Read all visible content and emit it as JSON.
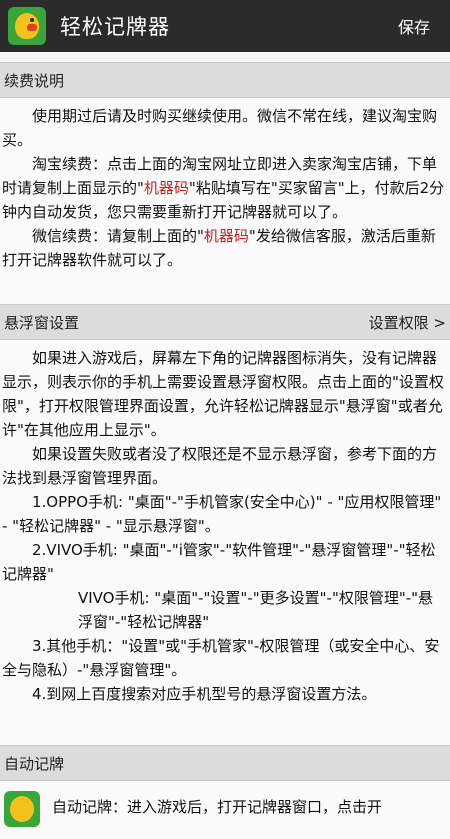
{
  "appbar": {
    "title": "轻松记牌器",
    "save_label": "保存"
  },
  "renewal": {
    "header": "续费说明",
    "p1": "使用期过后请及时购买继续使用。微信不常在线，建议淘宝购买。",
    "p2_prefix": "淘宝续费：点击上面的淘宝网址立即进入卖家淘宝店铺，下单时请复制上面显示的\"",
    "machine_code_1": "机器码",
    "p2_suffix": "\"粘贴填写在\"买家留言\"上，付款后2分钟内自动发货，您只需要重新打开记牌器就可以了。",
    "p3_prefix": "微信续费：请复制上面的\"",
    "machine_code_2": "机器码",
    "p3_suffix": "\"发给微信客服，激活后重新打开记牌器软件就可以了。"
  },
  "floating": {
    "header": "悬浮窗设置",
    "permission_link": "设置权限 >",
    "p1": "如果进入游戏后，屏幕左下角的记牌器图标消失，没有记牌器显示，则表示你的手机上需要设置悬浮窗权限。点击上面的\"设置权限\"，打开权限管理界面设置，允许轻松记牌器显示\"悬浮窗\"或者允许\"在其他应用上显示\"。",
    "p2": "如果设置失败或者没了权限还是不显示悬浮窗，参考下面的方法找到悬浮窗管理界面。",
    "oppo": "1.OPPO手机: \"桌面\"-\"手机管家(安全中心)\" - \"应用权限管理\" - \"轻松记牌器\" - \"显示悬浮窗\"。",
    "vivo1": "2.VIVO手机: \"桌面\"-\"i管家\"-\"软件管理\"-\"悬浮窗管理\"-\"轻松记牌器\"",
    "vivo2": "VIVO手机: \"桌面\"-\"设置\"-\"更多设置\"-\"权限管理\"-\"悬浮窗\"-\"轻松记牌器\"",
    "other": "3.其他手机：\"设置\"或\"手机管家\"-权限管理（或安全中心、安全与隐私）-\"悬浮窗管理\"。",
    "baidu": "4.到网上百度搜索对应手机型号的悬浮窗设置方法。"
  },
  "auto": {
    "header": "自动记牌",
    "text": "自动记牌：进入游戏后，打开记牌器窗口，点击开"
  },
  "colors": {
    "appbar": "#2b2b2b",
    "highlight": "#cc1f1f",
    "icon_bg": "#3aa53a"
  },
  "icons": {
    "app": "bird-app-icon"
  }
}
